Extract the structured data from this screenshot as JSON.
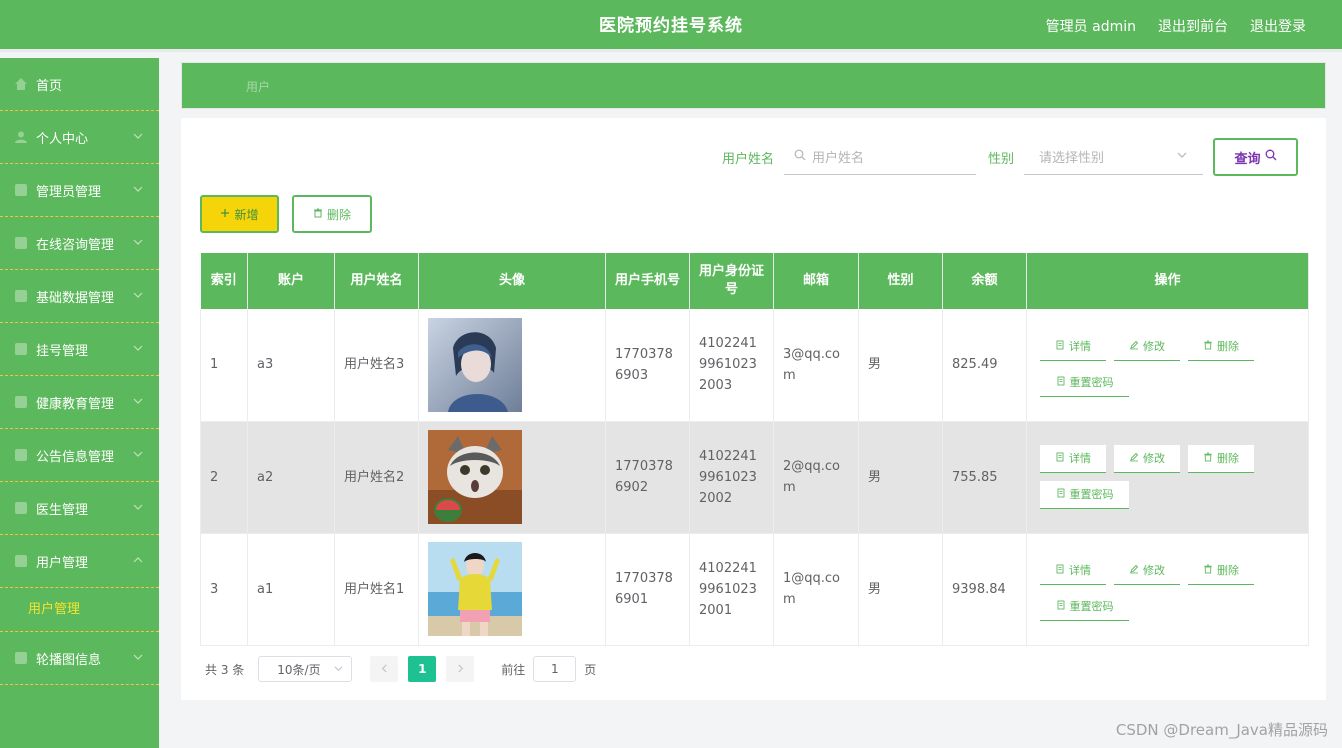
{
  "header": {
    "title": "医院预约挂号系统",
    "admin": "管理员 admin",
    "to_front": "退出到前台",
    "logout": "退出登录"
  },
  "sidebar": {
    "items": [
      {
        "label": "首页",
        "icon": "home-icon",
        "expandable": false
      },
      {
        "label": "个人中心",
        "icon": "user-icon",
        "expandable": true
      },
      {
        "label": "管理员管理",
        "icon": "admin-icon",
        "expandable": true
      },
      {
        "label": "在线咨询管理",
        "icon": "chat-icon",
        "expandable": true
      },
      {
        "label": "基础数据管理",
        "icon": "data-icon",
        "expandable": true
      },
      {
        "label": "挂号管理",
        "icon": "register-icon",
        "expandable": true
      },
      {
        "label": "健康教育管理",
        "icon": "book-icon",
        "expandable": true
      },
      {
        "label": "公告信息管理",
        "icon": "notice-icon",
        "expandable": true
      },
      {
        "label": "医生管理",
        "icon": "doctor-icon",
        "expandable": true
      },
      {
        "label": "用户管理",
        "icon": "users-icon",
        "expandable": true,
        "open": true
      },
      {
        "label": "轮播图信息",
        "icon": "carousel-icon",
        "expandable": true
      }
    ],
    "submenu": {
      "label": "用户管理"
    }
  },
  "breadcrumb": {
    "current": "用户"
  },
  "search": {
    "name_label": "用户姓名",
    "name_placeholder": "用户姓名",
    "gender_label": "性别",
    "gender_placeholder": "请选择性别",
    "query_label": "查询"
  },
  "actions": {
    "add_label": "新增",
    "delete_label": "删除"
  },
  "table": {
    "columns": [
      "索引",
      "账户",
      "用户姓名",
      "头像",
      "用户手机号",
      "用户身份证号",
      "邮箱",
      "性别",
      "余额",
      "操作"
    ],
    "rows": [
      {
        "index": "1",
        "account": "a3",
        "name": "用户姓名3",
        "phone": "17703786903",
        "id_card": "410224199610232003",
        "email": "3@qq.com",
        "gender": "男",
        "balance": "825.49",
        "avatar": "anime-boy-avatar"
      },
      {
        "index": "2",
        "account": "a2",
        "name": "用户姓名2",
        "phone": "17703786902",
        "id_card": "410224199610232002",
        "email": "2@qq.com",
        "gender": "男",
        "balance": "755.85",
        "avatar": "cat-avatar"
      },
      {
        "index": "3",
        "account": "a1",
        "name": "用户姓名1",
        "phone": "17703786901",
        "id_card": "410224199610232001",
        "email": "1@qq.com",
        "gender": "男",
        "balance": "9398.84",
        "avatar": "girl-beach-avatar"
      }
    ],
    "op_labels": {
      "detail": "详情",
      "edit": "修改",
      "delete": "删除",
      "reset": "重置密码"
    }
  },
  "pagination": {
    "total": "共 3 条",
    "page_size": "10条/页",
    "current": "1",
    "goto_prefix": "前往",
    "goto_value": "1",
    "goto_suffix": "页"
  },
  "watermark": "CSDN @Dream_Java精品源码",
  "colors": {
    "primary": "#5cb85c",
    "accent_yellow": "#f5d50a",
    "page_active": "#1ec192"
  }
}
